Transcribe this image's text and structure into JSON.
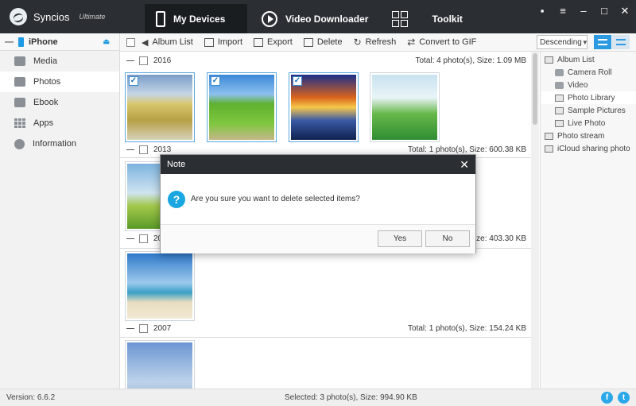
{
  "app": {
    "name": "Syncios",
    "edition": "Ultimate"
  },
  "topnav": [
    {
      "label": "My Devices",
      "icon": "phone-icon"
    },
    {
      "label": "Video Downloader",
      "icon": "play-icon"
    },
    {
      "label": "Toolkit",
      "icon": "toolkit-icon"
    }
  ],
  "window_controls": [
    "message-icon",
    "menu-icon",
    "minimize-icon",
    "maximize-icon",
    "close-icon"
  ],
  "sidebar": {
    "device": "iPhone",
    "items": [
      {
        "label": "Media",
        "icon": "media-icon"
      },
      {
        "label": "Photos",
        "icon": "photos-icon"
      },
      {
        "label": "Ebook",
        "icon": "ebook-icon"
      },
      {
        "label": "Apps",
        "icon": "apps-icon"
      },
      {
        "label": "Information",
        "icon": "info-icon"
      }
    ]
  },
  "toolbar": {
    "album_list": "Album List",
    "import": "Import",
    "export": "Export",
    "delete": "Delete",
    "refresh": "Refresh",
    "convert": "Convert to GIF",
    "sort": "Descending"
  },
  "groups": [
    {
      "year": "2016",
      "stat": "Total: 4 photo(s), Size: 1.09 MB"
    },
    {
      "year": "2013",
      "stat": "Total: 1 photo(s), Size: 600.38 KB"
    },
    {
      "year": "20",
      "stat": "Total: 1 photo(s), Size: 403.30 KB"
    },
    {
      "year": "2007",
      "stat": "Total: 1 photo(s), Size: 154.24 KB"
    }
  ],
  "albums": [
    {
      "label": "Album List"
    },
    {
      "label": "Camera Roll"
    },
    {
      "label": "Video"
    },
    {
      "label": "Photo Library"
    },
    {
      "label": "Sample Pictures"
    },
    {
      "label": "Live Photo"
    },
    {
      "label": "Photo stream"
    },
    {
      "label": "iCloud sharing photo"
    }
  ],
  "status": {
    "version": "Version: 6.6.2",
    "selected": "Selected: 3 photo(s), Size: 994.90 KB"
  },
  "dialog": {
    "title": "Note",
    "message": "Are you sure you want to delete selected items?",
    "yes": "Yes",
    "no": "No"
  },
  "colors": {
    "accent": "#1e9be2",
    "titlebar": "#2b2f33"
  }
}
